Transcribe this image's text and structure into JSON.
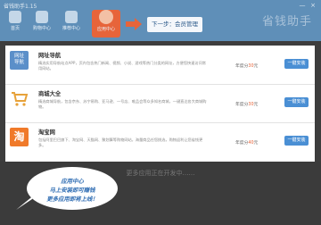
{
  "window": {
    "title": "省钱助手1.15",
    "controls": [
      "—",
      "×"
    ]
  },
  "nav": {
    "tabs": [
      {
        "label": "首页"
      },
      {
        "label": "购物中心"
      },
      {
        "label": "推荐中心"
      },
      {
        "label": "应用中心"
      }
    ],
    "active_index": 3
  },
  "next_button": {
    "label": "下一步：会员管理"
  },
  "brand": {
    "text": "省钱助手"
  },
  "apps": [
    {
      "name": "网址导航",
      "desc": "精选实用导航站点APP，页内包含热门新闻、视频、小说、游戏等热门分类的网址，方便您快速访问常用网站。",
      "reward_prefix": "年度分",
      "reward_value": "30",
      "reward_suffix": "元",
      "button": "一键安装",
      "icon_color": "#5b8fc9",
      "icon_text": "网址导航"
    },
    {
      "name": "商城大全",
      "desc": "精选商城导航，包含京东、苏宁易购、亚马逊、一号店、唯品会等众多知名商城，一键直达各大商城购物。",
      "reward_prefix": "年度分",
      "reward_value": "30",
      "reward_suffix": "元",
      "button": "一键安装",
      "icon_color": "#e7a23a",
      "icon_text": "商"
    },
    {
      "name": "淘宝网",
      "desc": "包括阿里巴巴旗下、淘宝网、天猫网、聚划算等购物网站，海量商品任您挑选，购物返利让您省钱更多。",
      "reward_prefix": "年度分",
      "reward_value": "40",
      "reward_suffix": "元",
      "button": "一键安装",
      "icon_color": "#f07a2a",
      "icon_text": "淘"
    }
  ],
  "hint": "更多应用正在开发中……",
  "callout": {
    "line1": "应用中心",
    "line2": "马上安装即可赚钱",
    "line3": "更多应用即将上线！"
  },
  "colors": {
    "topbar": "#5f8fb8",
    "accent": "#e7643a",
    "button": "#4a8fd4"
  }
}
